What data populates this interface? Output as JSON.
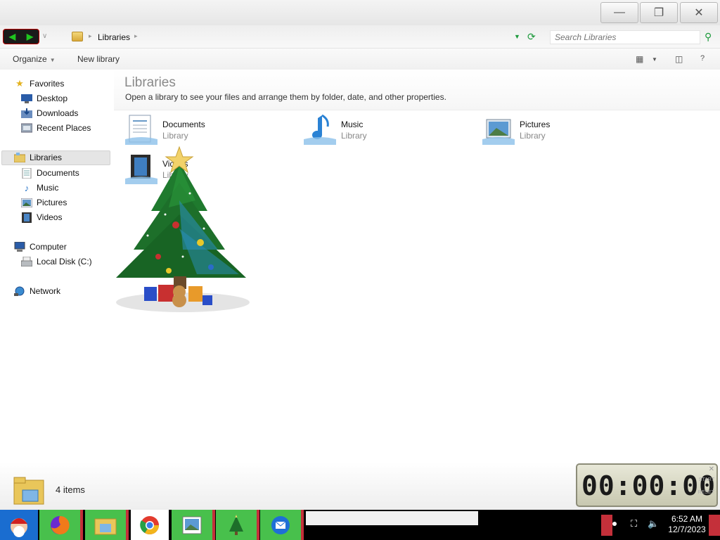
{
  "window": {
    "minimize_glyph": "—",
    "maximize_glyph": "❐",
    "close_glyph": "✕"
  },
  "address": {
    "back_glyph": "◀",
    "forward_glyph": "▶",
    "breadcrumb": "Libraries",
    "search_placeholder": "Search Libraries"
  },
  "toolbar": {
    "organize": "Organize",
    "new_library": "New library"
  },
  "sidebar": {
    "favorites": "Favorites",
    "desktop": "Desktop",
    "downloads": "Downloads",
    "recent_places": "Recent Places",
    "libraries": "Libraries",
    "documents": "Documents",
    "music": "Music",
    "pictures": "Pictures",
    "videos": "Videos",
    "computer": "Computer",
    "local_disk": "Local Disk (C:)",
    "network": "Network"
  },
  "main": {
    "title": "Libraries",
    "subtitle": "Open a library to see your files and arrange them by folder, date, and other properties.",
    "libraries": [
      {
        "name": "Documents",
        "type": "Library"
      },
      {
        "name": "Music",
        "type": "Library"
      },
      {
        "name": "Pictures",
        "type": "Library"
      },
      {
        "name": "Videos",
        "type": "Library"
      }
    ]
  },
  "details": {
    "count": "4 items"
  },
  "clock": {
    "display": "00:00:00"
  },
  "taskbar": {
    "time": "6:52 AM",
    "date": "12/7/2023"
  }
}
